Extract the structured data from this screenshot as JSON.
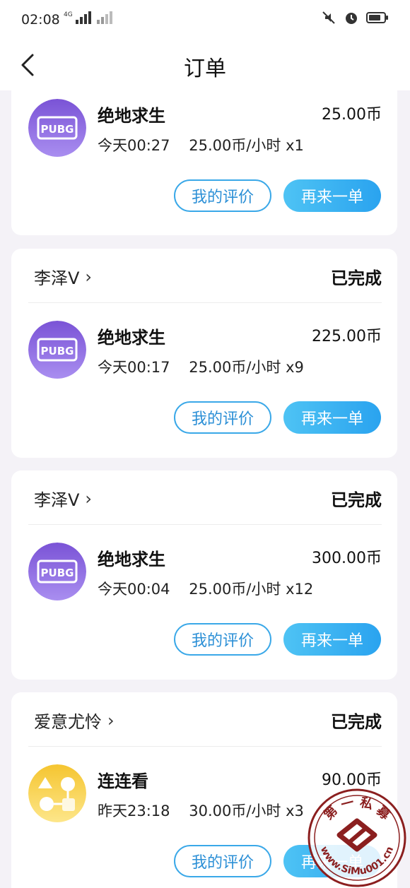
{
  "status_bar": {
    "time": "02:08",
    "network": "4G"
  },
  "header": {
    "title": "订单"
  },
  "actions": {
    "review_label": "我的评价",
    "reorder_label": "再来一单"
  },
  "orders": [
    {
      "seller": "",
      "status": "",
      "game": "绝地求生",
      "price": "25.00币",
      "meta": "今天00:27    25.00币/小时 x1",
      "icon": "pubg-icon"
    },
    {
      "seller": "李泽V",
      "status": "已完成",
      "game": "绝地求生",
      "price": "225.00币",
      "meta": "今天00:17    25.00币/小时 x9",
      "icon": "pubg-icon"
    },
    {
      "seller": "李泽V",
      "status": "已完成",
      "game": "绝地求生",
      "price": "300.00币",
      "meta": "今天00:04    25.00币/小时 x12",
      "icon": "pubg-icon"
    },
    {
      "seller": "爱意尤怜",
      "status": "已完成",
      "game": "连连看",
      "price": "90.00币",
      "meta": "昨天23:18    30.00币/小时 x3",
      "icon": "lianliankan-icon"
    }
  ],
  "watermark": {
    "text_top": "第 一 私 募",
    "text_bottom": "www.SiMu001.cn"
  }
}
